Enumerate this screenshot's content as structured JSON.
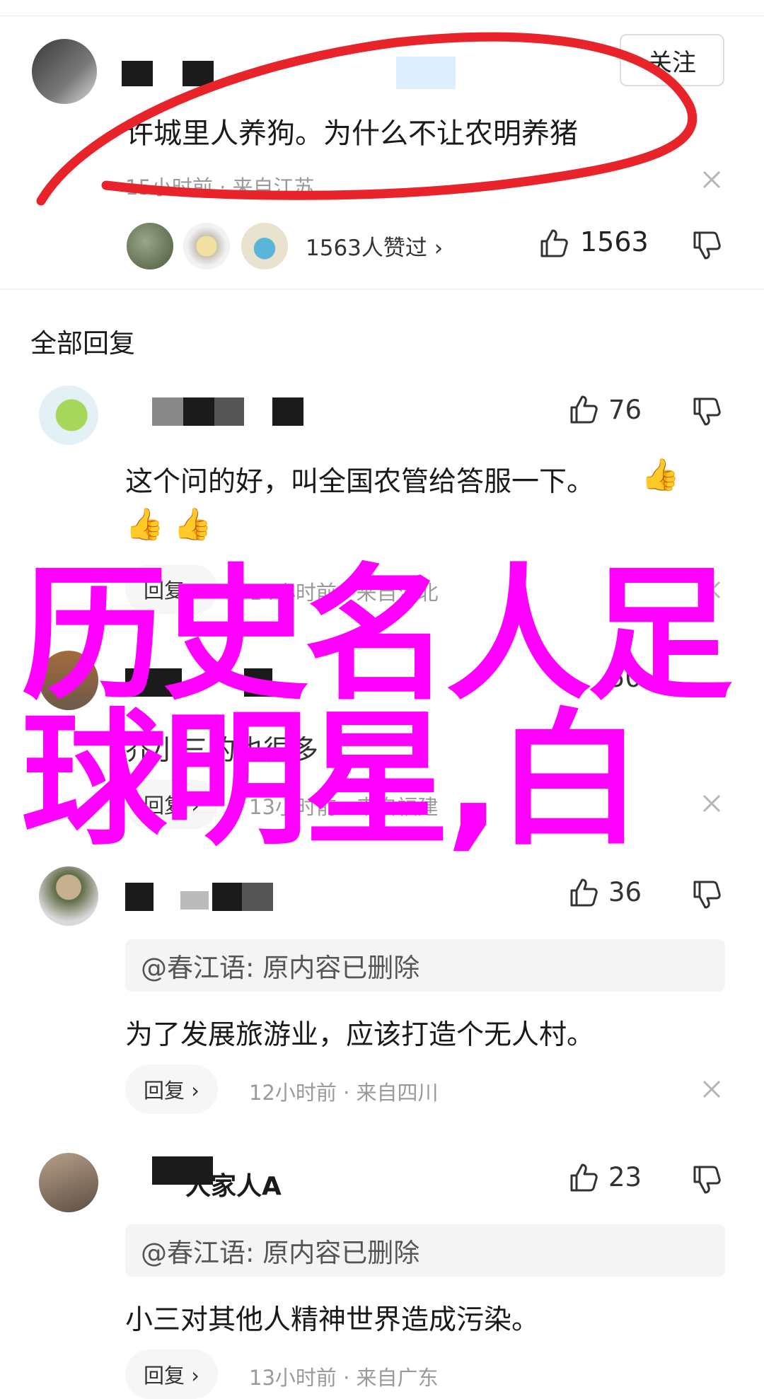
{
  "post": {
    "follow_label": "关注",
    "text": "许城里人养狗。为什么不让农明养猪",
    "meta": "15小时前 · 来自江苏",
    "likers_label": "1563人赞过 ›",
    "like_count": "1563"
  },
  "replies_section": {
    "title": "全部回复"
  },
  "comments": [
    {
      "like_count": "76",
      "text": "这个问的好，叫全国农管给答服一下。",
      "emoji": [
        "👍",
        "👍",
        "👍"
      ],
      "reply_label": "回复 ›",
      "meta": "14小时前 · 来自河北"
    },
    {
      "like_count": "50",
      "text": "乔小三的也很多",
      "reply_label": "回复 ›",
      "meta": "13小时前 · 来自福建"
    },
    {
      "like_count": "36",
      "quote": "@春江语: 原内容已删除",
      "text": "为了发展旅游业，应该打造个无人村。",
      "reply_label": "回复 ›",
      "meta": "12小时前 · 来自四川"
    },
    {
      "like_count": "23",
      "username_suffix": "人家人A",
      "quote": "@春江语: 原内容已删除",
      "text": "小三对其他人精神世界造成污染。",
      "reply_label": "回复 ›",
      "meta": "13小时前 · 来自广东"
    }
  ],
  "overlay": {
    "line1": "历史名人足",
    "line2": "球明星,白"
  },
  "colors": {
    "overlay": "#ff00ff",
    "scribble": "#e8232a",
    "muted": "#9a9a9a"
  }
}
